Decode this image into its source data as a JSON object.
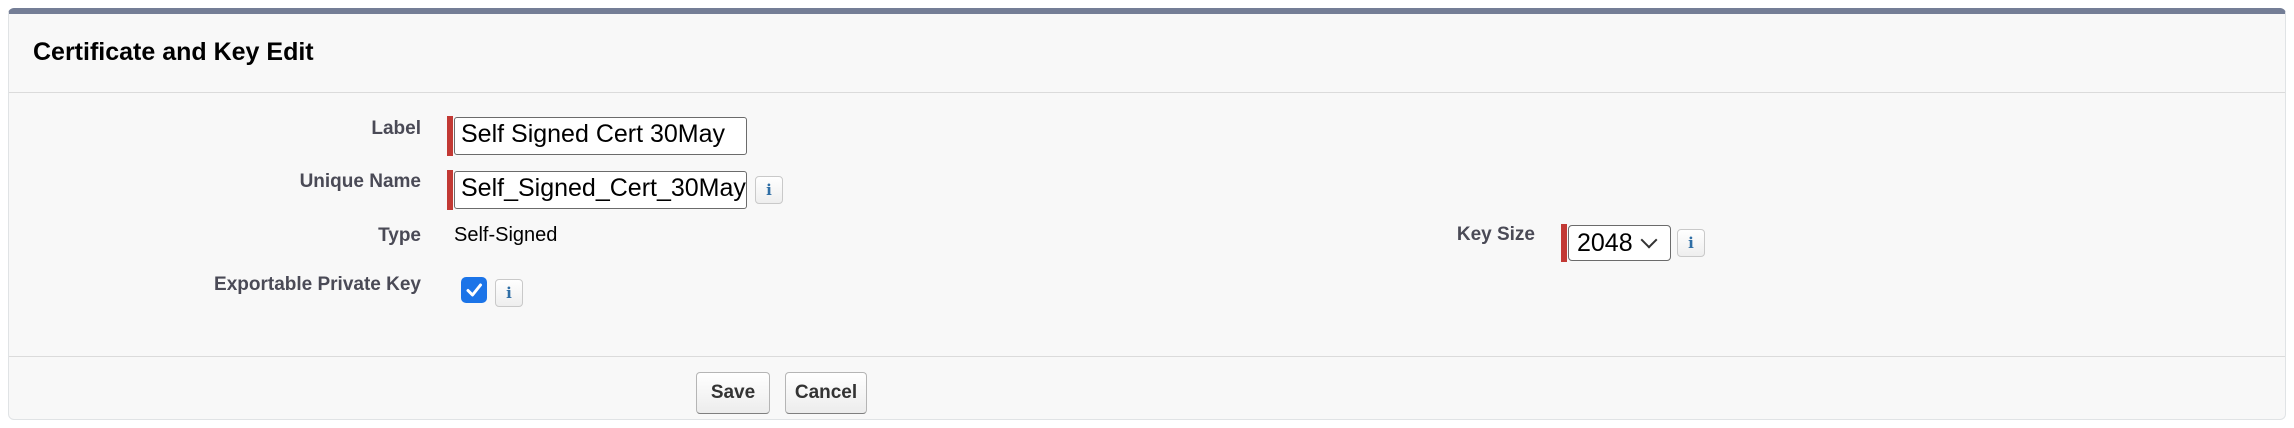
{
  "header": {
    "title": "Certificate and Key Edit"
  },
  "fields": {
    "label": {
      "label": "Label",
      "value": "Self Signed Cert 30May"
    },
    "unique_name": {
      "label": "Unique Name",
      "value": "Self_Signed_Cert_30May"
    },
    "type": {
      "label": "Type",
      "value": "Self-Signed"
    },
    "exportable": {
      "label": "Exportable Private Key",
      "checked": true
    },
    "key_size": {
      "label": "Key Size",
      "selected": "2048"
    }
  },
  "icons": {
    "info": "info-icon",
    "check": "checkmark-icon",
    "select_arrow": "chevron-down-icon"
  },
  "buttons": {
    "save": "Save",
    "cancel": "Cancel"
  },
  "colors": {
    "required": "#c23934",
    "header_accent": "#747e96",
    "checkbox": "#1b74e8",
    "info_glyph": "#2f6ea5"
  },
  "glyphs": {
    "info": "i"
  }
}
